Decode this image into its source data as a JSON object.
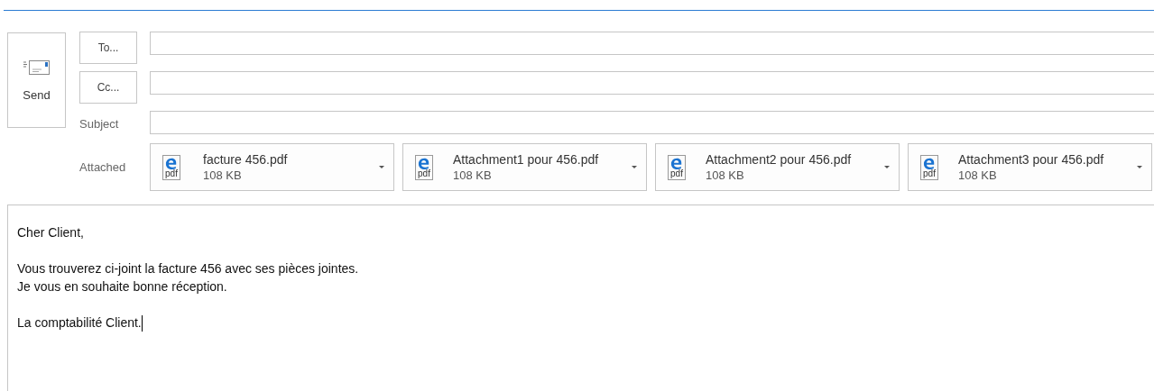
{
  "send_button": {
    "label": "Send"
  },
  "to_button": {
    "label": "To..."
  },
  "cc_button": {
    "label": "Cc..."
  },
  "subject": {
    "label": "Subject"
  },
  "attached": {
    "label": "Attached",
    "files": [
      {
        "name": "facture 456.pdf",
        "size": "108 KB",
        "icon_label": "pdf"
      },
      {
        "name": "Attachment1 pour 456.pdf",
        "size": "108 KB",
        "icon_label": "pdf"
      },
      {
        "name": "Attachment2 pour 456.pdf",
        "size": "108 KB",
        "icon_label": "pdf"
      },
      {
        "name": "Attachment3 pour 456.pdf",
        "size": "108 KB",
        "icon_label": "pdf"
      }
    ]
  },
  "body": {
    "paragraphs": [
      [
        "Cher Client,"
      ],
      [
        "Vous trouverez ci-joint la facture 456 avec ses pièces jointes.",
        "Je vous en souhaite bonne réception."
      ],
      [
        "La comptabilité Client."
      ]
    ],
    "cursor_at_end": true
  }
}
